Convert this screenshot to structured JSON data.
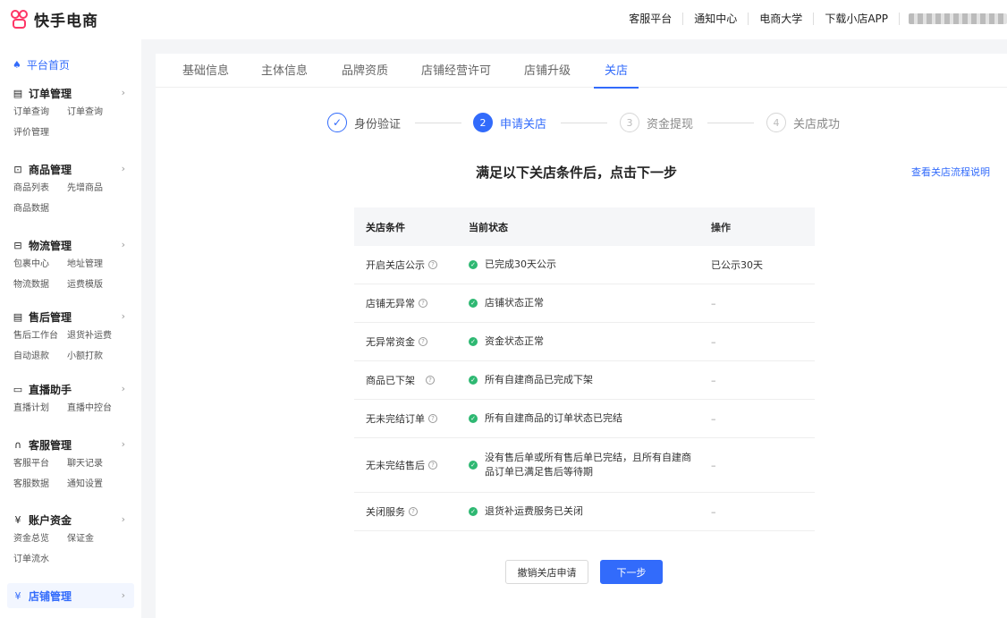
{
  "brand": {
    "name": "快手电商"
  },
  "header": {
    "links": [
      "客服平台",
      "通知中心",
      "电商大学",
      "下载小店APP"
    ]
  },
  "sidebar": {
    "home": "平台首页",
    "groups": [
      {
        "title": "订单管理",
        "items": [
          "订单查询",
          "订单查询",
          "评价管理"
        ]
      },
      {
        "title": "商品管理",
        "items": [
          "商品列表",
          "先增商品",
          "商品数据"
        ]
      },
      {
        "title": "物流管理",
        "items": [
          "包裹中心",
          "地址管理",
          "物流数据",
          "运费模版"
        ]
      },
      {
        "title": "售后管理",
        "items": [
          "售后工作台",
          "退货补运费",
          "自动退款",
          "小额打款"
        ]
      },
      {
        "title": "直播助手",
        "items": [
          "直播计划",
          "直播中控台"
        ]
      },
      {
        "title": "客服管理",
        "items": [
          "客服平台",
          "聊天记录",
          "客服数据",
          "通知设置"
        ]
      },
      {
        "title": "账户资金",
        "items": [
          "资金总览",
          "保证金",
          "订单流水"
        ]
      },
      {
        "title": "店铺管理",
        "items": []
      }
    ]
  },
  "tabs": [
    "基础信息",
    "主体信息",
    "品牌资质",
    "店铺经营许可",
    "店铺升级",
    "关店"
  ],
  "steps": [
    {
      "num": "✓",
      "label": "身份验证",
      "state": "done"
    },
    {
      "num": "2",
      "label": "申请关店",
      "state": "current"
    },
    {
      "num": "3",
      "label": "资金提现",
      "state": "todo"
    },
    {
      "num": "4",
      "label": "关店成功",
      "state": "todo"
    }
  ],
  "main": {
    "heading": "满足以下关店条件后，点击下一步",
    "help_link": "查看关店流程说明"
  },
  "table": {
    "headers": [
      "关店条件",
      "当前状态",
      "操作"
    ],
    "rows": [
      {
        "condition": "开启关店公示",
        "status": "已完成30天公示",
        "action": "已公示30天"
      },
      {
        "condition": "店铺无异常",
        "status": "店铺状态正常",
        "action": "–"
      },
      {
        "condition": "无异常资金",
        "status": "资金状态正常",
        "action": "–"
      },
      {
        "condition": "商品已下架",
        "status": "所有自建商品已完成下架",
        "action": "–"
      },
      {
        "condition": "无未完结订单",
        "status": "所有自建商品的订单状态已完结",
        "action": "–"
      },
      {
        "condition": "无未完结售后",
        "status": "没有售后单或所有售后单已完结，且所有自建商品订单已满足售后等待期",
        "action": "–"
      },
      {
        "condition": "关闭服务",
        "status": "退货补运费服务已关闭",
        "action": "–"
      }
    ]
  },
  "buttons": {
    "cancel": "撤销关店申请",
    "next": "下一步"
  },
  "colors": {
    "primary": "#326bfb",
    "success": "#2eb872",
    "brand": "#fe3666"
  }
}
